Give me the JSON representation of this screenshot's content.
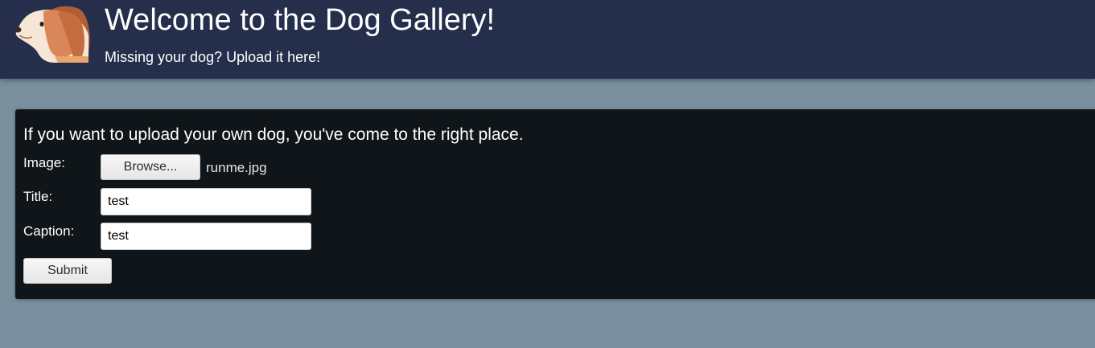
{
  "header": {
    "title": "Welcome to the Dog Gallery!",
    "subtitle": "Missing your dog? Upload it here!",
    "logo_icon": "dog-head-icon"
  },
  "upload_form": {
    "heading": "If you want to upload your own dog, you've come to the right place.",
    "image_label": "Image:",
    "browse_label": "Browse...",
    "selected_file": "runme.jpg",
    "title_label": "Title:",
    "title_value": "test",
    "caption_label": "Caption:",
    "caption_value": "test",
    "submit_label": "Submit"
  },
  "colors": {
    "header_bg": "#252f4c",
    "page_bg": "#7a909e",
    "panel_bg": "#0f1518"
  }
}
